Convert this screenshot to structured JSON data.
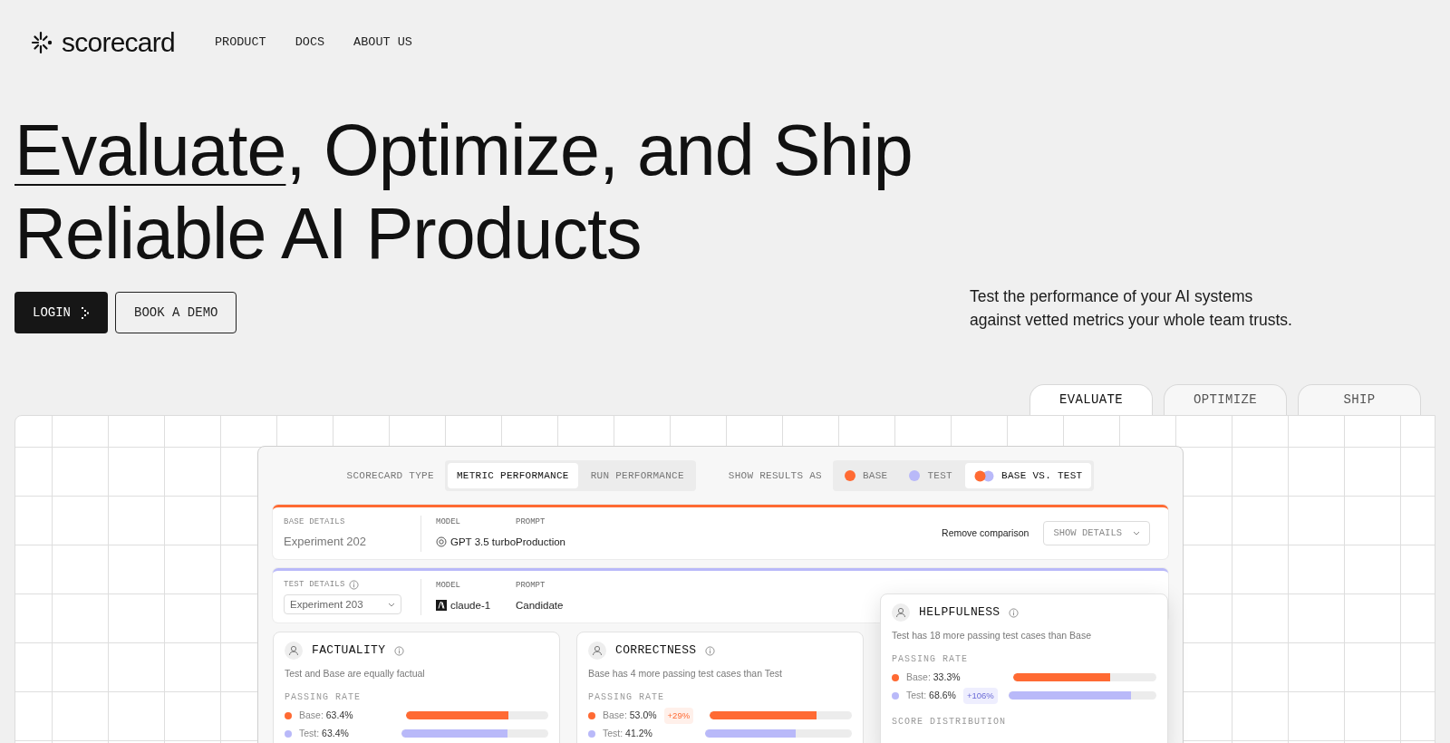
{
  "nav": {
    "logo": "scorecard",
    "links": [
      "PRODUCT",
      "DOCS",
      "ABOUT US"
    ]
  },
  "hero": {
    "lines": [
      [
        {
          "text": "Evaluate",
          "underlined": true
        },
        {
          "text": ", Optimize, and Ship",
          "underlined": false
        }
      ],
      [
        {
          "text": "Reliable AI Products",
          "underlined": false
        }
      ]
    ],
    "buttons": [
      {
        "label": "LOGIN",
        "kind": "primary"
      },
      {
        "label": "BOOK A DEMO",
        "kind": "secondary"
      }
    ],
    "tagline": "Test the performance of your AI systems against vetted metrics your whole team trusts."
  },
  "tabs": [
    {
      "label": "EVALUATE",
      "selected": true
    },
    {
      "label": "OPTIMIZE",
      "selected": false
    },
    {
      "label": "SHIP",
      "selected": false
    }
  ],
  "scorecard": {
    "type_label": "SCORECARD TYPE",
    "type_options": [
      {
        "label": "METRIC PERFORMANCE",
        "selected": true
      },
      {
        "label": "RUN PERFORMANCE",
        "selected": false
      }
    ],
    "results_label": "SHOW RESULTS AS",
    "results_options": [
      {
        "label": "BASE",
        "kind": "base",
        "selected": false
      },
      {
        "label": "TEST",
        "kind": "test",
        "selected": false
      },
      {
        "label": "BASE VS. TEST",
        "kind": "both",
        "selected": true
      }
    ],
    "details": [
      {
        "label": "BASE DETAILS",
        "info": false,
        "value": "Experiment 202",
        "dropdown": false,
        "color": "#ff6a33",
        "model_label": "MODEL",
        "model": "GPT 3.5 turbo",
        "prompt_label": "PROMPT",
        "prompt": "Production",
        "remove": "Remove comparison",
        "show_details": "SHOW DETAILS"
      },
      {
        "label": "TEST DETAILS",
        "info": true,
        "value": "Experiment 203",
        "dropdown": true,
        "color": "#b9b9f9",
        "model_label": "MODEL",
        "model": "claude-1",
        "prompt_label": "PROMPT",
        "prompt": "Candidate"
      }
    ],
    "metrics": [
      {
        "title": "FACTUALITY",
        "summary": "Test and Base are equally factual",
        "section": "PASSING RATE",
        "rows": [
          {
            "label": "Base:",
            "value": "63.4%",
            "color": "#ff6a33",
            "level": 0.72
          },
          {
            "label": "Test:",
            "value": "63.4%",
            "color": "#b9b9f9",
            "level": 0.72
          }
        ]
      },
      {
        "title": "CORRECTNESS",
        "summary": "Base has 4 more passing test cases than Test",
        "section": "PASSING RATE",
        "rows": [
          {
            "label": "Base:",
            "value": "53.0%",
            "change": "+29%",
            "color": "#ff6a33",
            "level": 0.75
          },
          {
            "label": "Test:",
            "value": "41.2%",
            "color": "#b9b9f9",
            "level": 0.62
          }
        ]
      },
      {
        "title": "HELPFULNESS",
        "summary": "Test has 18 more passing test cases than Base",
        "section": "PASSING RATE",
        "rows": [
          {
            "label": "Base:",
            "value": "33.3%",
            "color": "#ff6a33",
            "level": 0.68
          },
          {
            "label": "Test:",
            "value": "68.6%",
            "change": "+106%",
            "color": "#b9b9f9",
            "level": 0.83
          }
        ],
        "section2": "SCORE DISTRIBUTION"
      }
    ]
  }
}
